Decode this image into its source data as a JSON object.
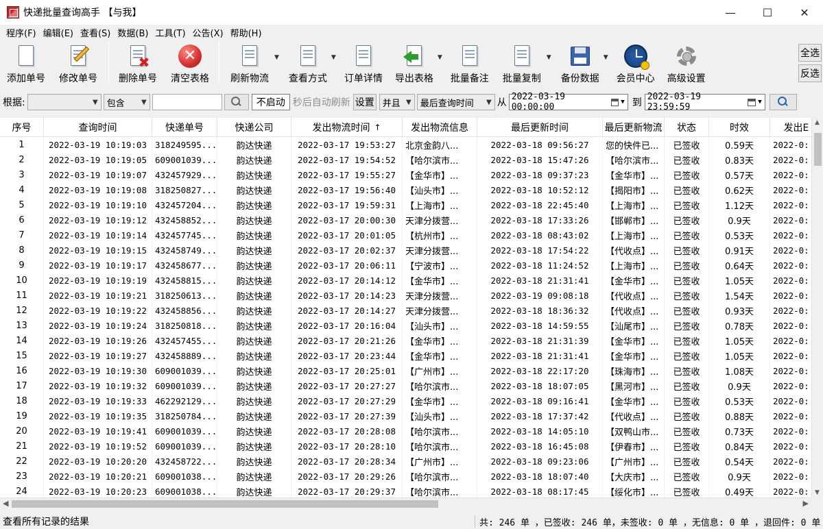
{
  "window": {
    "title": "快递批量查询高手 【与我】",
    "minimize": "—",
    "maximize": "☐",
    "close": "✕"
  },
  "menu": [
    "程序(F)",
    "编辑(E)",
    "查看(S)",
    "数据(B)",
    "工具(T)",
    "公告(X)",
    "帮助(H)"
  ],
  "toolbar": {
    "add": "添加单号",
    "edit": "修改单号",
    "delete": "删除单号",
    "clear": "清空表格",
    "refresh": "刷新物流",
    "view_mode": "查看方式",
    "order_detail": "订单详情",
    "export": "导出表格",
    "batch_note": "批量备注",
    "batch_copy": "批量复制",
    "backup": "备份数据",
    "member": "会员中心",
    "advanced": "高级设置",
    "select_all": "全选",
    "invert": "反选"
  },
  "filter": {
    "by_label": "根据:",
    "by_value": "",
    "match_value": "包含",
    "search_value": "",
    "auto_toggle": "不启动",
    "auto_label": "秒后自动刷新",
    "settings": "设置",
    "logic": "并且",
    "time_field": "最后查询时间",
    "from_label": "从",
    "from_value": "2022-03-19 00:00:00",
    "to_label": "到",
    "to_value": "2022-03-19 23:59:59"
  },
  "grid": {
    "columns": [
      "序号",
      "查询时间",
      "快递单号",
      "快递公司",
      "发出物流时间",
      "发出物流信息",
      "最后更新时间",
      "最后更新物流",
      "状态",
      "时效",
      "发出E"
    ],
    "sort_indicator": "↑",
    "rows": [
      [
        "1",
        "2022-03-19 10:19:03",
        "318249595...",
        "韵达快递",
        "2022-03-17 19:53:27",
        "北京金韵八...",
        "2022-03-18 09:56:27",
        "您的快件已...",
        "已签收",
        "0.59天",
        "2022-0:"
      ],
      [
        "2",
        "2022-03-19 10:19:05",
        "609001039...",
        "韵达快递",
        "2022-03-17 19:54:52",
        "【哈尔滨市...",
        "2022-03-18 15:47:26",
        "【哈尔滨市...",
        "已签收",
        "0.83天",
        "2022-0:"
      ],
      [
        "3",
        "2022-03-19 10:19:07",
        "432457929...",
        "韵达快递",
        "2022-03-17 19:55:27",
        "【金华市】...",
        "2022-03-18 09:37:23",
        "【金华市】...",
        "已签收",
        "0.57天",
        "2022-0:"
      ],
      [
        "4",
        "2022-03-19 10:19:08",
        "318250827...",
        "韵达快递",
        "2022-03-17 19:56:40",
        "【汕头市】...",
        "2022-03-18 10:52:12",
        "【揭阳市】...",
        "已签收",
        "0.62天",
        "2022-0:"
      ],
      [
        "5",
        "2022-03-19 10:19:10",
        "432457204...",
        "韵达快递",
        "2022-03-17 19:59:31",
        "【上海市】...",
        "2022-03-18 22:45:40",
        "【上海市】...",
        "已签收",
        "1.12天",
        "2022-0:"
      ],
      [
        "6",
        "2022-03-19 10:19:12",
        "432458852...",
        "韵达快递",
        "2022-03-17 20:00:30",
        "天津分拨营...",
        "2022-03-18 17:33:26",
        "【邯郸市】...",
        "已签收",
        "0.9天",
        "2022-0:"
      ],
      [
        "7",
        "2022-03-19 10:19:14",
        "432457745...",
        "韵达快递",
        "2022-03-17 20:01:05",
        "【杭州市】...",
        "2022-03-18 08:43:02",
        "【上海市】...",
        "已签收",
        "0.53天",
        "2022-0:"
      ],
      [
        "8",
        "2022-03-19 10:19:15",
        "432458749...",
        "韵达快递",
        "2022-03-17 20:02:37",
        "天津分拨营...",
        "2022-03-18 17:54:22",
        "【代收点】...",
        "已签收",
        "0.91天",
        "2022-0:"
      ],
      [
        "9",
        "2022-03-19 10:19:17",
        "432458677...",
        "韵达快递",
        "2022-03-17 20:06:11",
        "【宁波市】...",
        "2022-03-18 11:24:52",
        "【上海市】...",
        "已签收",
        "0.64天",
        "2022-0:"
      ],
      [
        "10",
        "2022-03-19 10:19:19",
        "432458815...",
        "韵达快递",
        "2022-03-17 20:14:12",
        "【金华市】...",
        "2022-03-18 21:31:41",
        "【金华市】...",
        "已签收",
        "1.05天",
        "2022-0:"
      ],
      [
        "11",
        "2022-03-19 10:19:21",
        "318250613...",
        "韵达快递",
        "2022-03-17 20:14:23",
        "天津分拨营...",
        "2022-03-19 09:08:18",
        "【代收点】...",
        "已签收",
        "1.54天",
        "2022-0:"
      ],
      [
        "12",
        "2022-03-19 10:19:22",
        "432458856...",
        "韵达快递",
        "2022-03-17 20:14:27",
        "天津分拨营...",
        "2022-03-18 18:36:32",
        "【代收点】...",
        "已签收",
        "0.93天",
        "2022-0:"
      ],
      [
        "13",
        "2022-03-19 10:19:24",
        "318250818...",
        "韵达快递",
        "2022-03-17 20:16:04",
        "【汕头市】...",
        "2022-03-18 14:59:55",
        "【汕尾市】...",
        "已签收",
        "0.78天",
        "2022-0:"
      ],
      [
        "14",
        "2022-03-19 10:19:26",
        "432457455...",
        "韵达快递",
        "2022-03-17 20:21:26",
        "【金华市】...",
        "2022-03-18 21:31:39",
        "【金华市】...",
        "已签收",
        "1.05天",
        "2022-0:"
      ],
      [
        "15",
        "2022-03-19 10:19:27",
        "432458889...",
        "韵达快递",
        "2022-03-17 20:23:44",
        "【金华市】...",
        "2022-03-18 21:31:41",
        "【金华市】...",
        "已签收",
        "1.05天",
        "2022-0:"
      ],
      [
        "16",
        "2022-03-19 10:19:30",
        "609001039...",
        "韵达快递",
        "2022-03-17 20:25:01",
        "【广州市】...",
        "2022-03-18 22:17:20",
        "【珠海市】...",
        "已签收",
        "1.08天",
        "2022-0:"
      ],
      [
        "17",
        "2022-03-19 10:19:32",
        "609001039...",
        "韵达快递",
        "2022-03-17 20:27:27",
        "【哈尔滨市...",
        "2022-03-18 18:07:05",
        "【黑河市】...",
        "已签收",
        "0.9天",
        "2022-0:"
      ],
      [
        "18",
        "2022-03-19 10:19:33",
        "462292129...",
        "韵达快递",
        "2022-03-17 20:27:29",
        "【金华市】...",
        "2022-03-18 09:16:41",
        "【金华市】...",
        "已签收",
        "0.53天",
        "2022-0:"
      ],
      [
        "19",
        "2022-03-19 10:19:35",
        "318250784...",
        "韵达快递",
        "2022-03-17 20:27:39",
        "【汕头市】...",
        "2022-03-18 17:37:42",
        "【代收点】...",
        "已签收",
        "0.88天",
        "2022-0:"
      ],
      [
        "20",
        "2022-03-19 10:19:41",
        "609001039...",
        "韵达快递",
        "2022-03-17 20:28:08",
        "【哈尔滨市...",
        "2022-03-18 14:05:10",
        "【双鸭山市...",
        "已签收",
        "0.73天",
        "2022-0:"
      ],
      [
        "21",
        "2022-03-19 10:19:52",
        "609001039...",
        "韵达快递",
        "2022-03-17 20:28:10",
        "【哈尔滨市...",
        "2022-03-18 16:45:08",
        "【伊春市】...",
        "已签收",
        "0.84天",
        "2022-0:"
      ],
      [
        "22",
        "2022-03-19 10:20:20",
        "432458722...",
        "韵达快递",
        "2022-03-17 20:28:34",
        "【广州市】...",
        "2022-03-18 09:23:06",
        "【广州市】...",
        "已签收",
        "0.54天",
        "2022-0:"
      ],
      [
        "23",
        "2022-03-19 10:20:21",
        "609001038...",
        "韵达快递",
        "2022-03-17 20:29:26",
        "【哈尔滨市...",
        "2022-03-18 18:07:40",
        "【大庆市】...",
        "已签收",
        "0.9天",
        "2022-0:"
      ],
      [
        "24",
        "2022-03-19 10:20:23",
        "609001038...",
        "韵达快递",
        "2022-03-17 20:29:37",
        "【哈尔滨市...",
        "2022-03-18 08:17:45",
        "【绥化市】...",
        "已签收",
        "0.49天",
        "2022-0:"
      ]
    ]
  },
  "status": {
    "left": "查看所有记录的结果",
    "right": "共: 246 单 ，已签收:  246 单，未签收:  0 单 ，无信息: 0 单 ，退回件: 0 单"
  }
}
